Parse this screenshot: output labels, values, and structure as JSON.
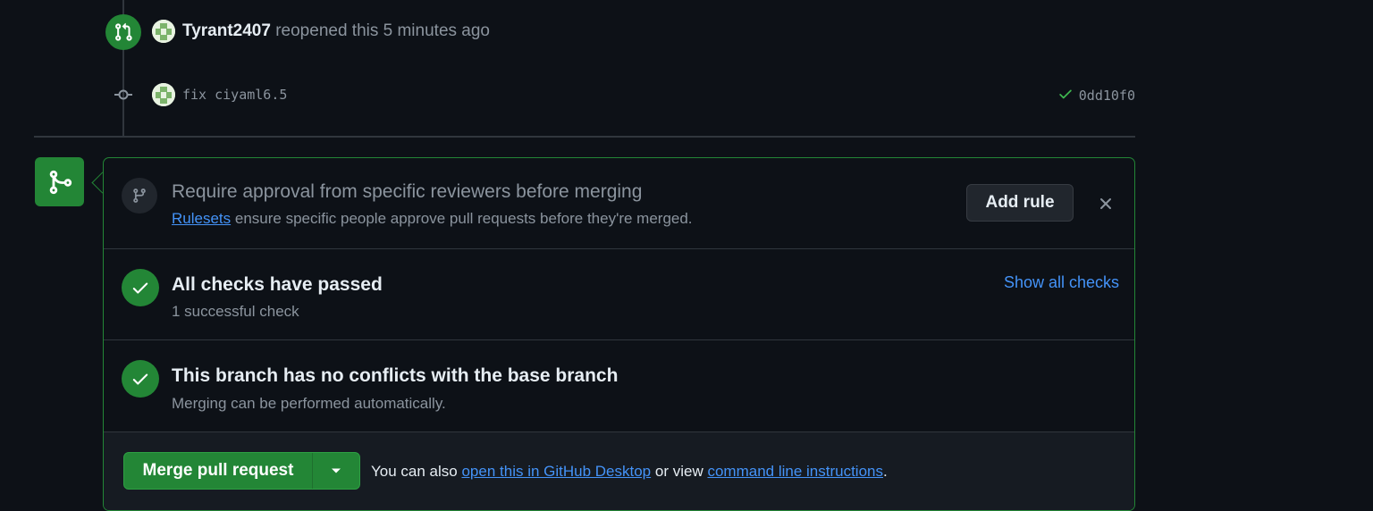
{
  "timeline": {
    "reopen": {
      "username": "Tyrant2407",
      "action": "reopened this 5 minutes ago"
    },
    "commit": {
      "message": "fix ciyaml6.5",
      "sha": "0dd10f0",
      "status": "success"
    }
  },
  "merge_box": {
    "ruleset_prompt": {
      "title": "Require approval from specific reviewers before merging",
      "link_text": "Rulesets",
      "description": "ensure specific people approve pull requests before they're merged.",
      "add_rule_label": "Add rule"
    },
    "checks": {
      "title": "All checks have passed",
      "subtitle": "1 successful check",
      "show_all_label": "Show all checks"
    },
    "conflicts": {
      "title": "This branch has no conflicts with the base branch",
      "subtitle": "Merging can be performed automatically."
    },
    "merge": {
      "button_label": "Merge pull request",
      "text_prefix": "You can also",
      "desktop_link": "open this in GitHub Desktop",
      "text_middle": "or view",
      "cli_link": "command line instructions",
      "text_suffix": "."
    }
  },
  "colors": {
    "background": "#0d1117",
    "success": "#238636",
    "link": "#4493f8",
    "muted": "#8b949e",
    "border": "#30363d"
  }
}
